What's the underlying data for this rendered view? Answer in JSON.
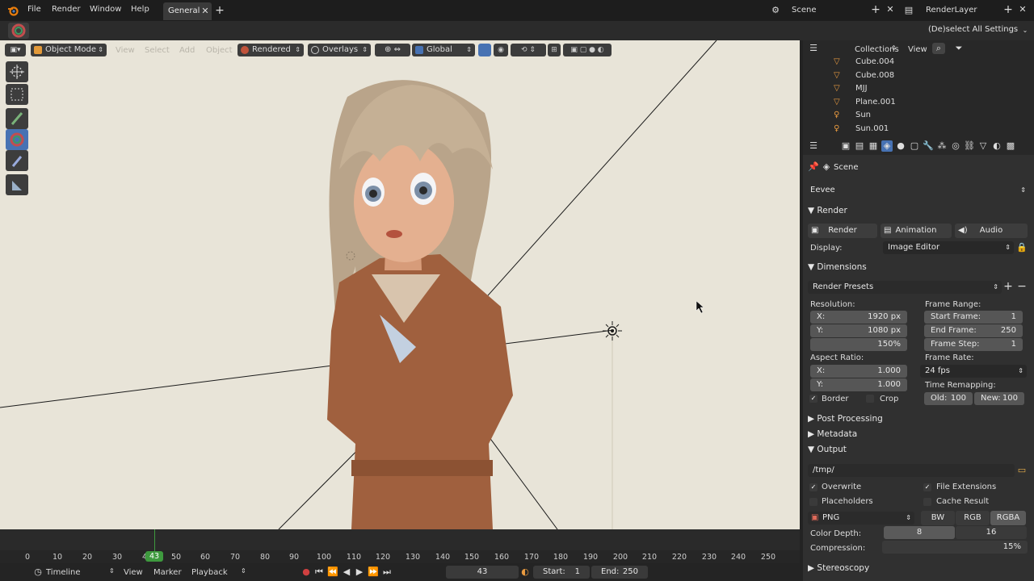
{
  "topbar": {
    "menus": [
      "File",
      "Render",
      "Window",
      "Help"
    ],
    "active_tab": "General",
    "add_tab": "+",
    "scene_name": "Scene",
    "layer_name": "RenderLayer"
  },
  "secondbar": {
    "deselect_settings": "(De)select All Settings"
  },
  "viewport": {
    "mode": "Object Mode",
    "menus": [
      "View",
      "Select",
      "Add",
      "Object"
    ],
    "shading": "Rendered",
    "overlays": "Overlays",
    "orientation": "Global"
  },
  "outliner": {
    "tabs": [
      "Collections",
      "View"
    ],
    "items": [
      "Cube.004",
      "Cube.008",
      "MJJ",
      "Plane.001",
      "Sun",
      "Sun.001"
    ]
  },
  "props": {
    "context": "Scene",
    "engine": "Eevee",
    "render_section": "Render",
    "render_buttons": [
      "Render",
      "Animation",
      "Audio"
    ],
    "display_label": "Display:",
    "display_value": "Image Editor",
    "dimensions_section": "Dimensions",
    "render_presets": "Render Presets",
    "resolution_label": "Resolution:",
    "res_x_label": "X:",
    "res_x": "1920 px",
    "res_y_label": "Y:",
    "res_y": "1080 px",
    "res_pct": "150%",
    "aspect_label": "Aspect Ratio:",
    "aspect_x_label": "X:",
    "aspect_x": "1.000",
    "aspect_y_label": "Y:",
    "aspect_y": "1.000",
    "border": "Border",
    "crop": "Crop",
    "frame_range_label": "Frame Range:",
    "start_frame_label": "Start Frame:",
    "start_frame": "1",
    "end_frame_label": "End Frame:",
    "end_frame": "250",
    "frame_step_label": "Frame Step:",
    "frame_step": "1",
    "frame_rate_label": "Frame Rate:",
    "frame_rate": "24 fps",
    "time_remap_label": "Time Remapping:",
    "old_label": "Old:",
    "old_value": "100",
    "new_label": "New:",
    "new_value": "100",
    "post_processing": "Post Processing",
    "metadata": "Metadata",
    "output_section": "Output",
    "output_path": "/tmp/",
    "overwrite": "Overwrite",
    "file_extensions": "File Extensions",
    "placeholders": "Placeholders",
    "cache_result": "Cache Result",
    "format": "PNG",
    "color_modes": [
      "BW",
      "RGB",
      "RGBA"
    ],
    "color_depth_label": "Color Depth:",
    "color_depth_options": [
      "8",
      "16"
    ],
    "compression_label": "Compression:",
    "compression": "15%",
    "stereoscopy": "Stereoscopy"
  },
  "timeline": {
    "ticks": [
      "0",
      "10",
      "20",
      "30",
      "4",
      "43",
      "50",
      "60",
      "70",
      "80",
      "90",
      "100",
      "110",
      "120",
      "130",
      "140",
      "150",
      "160",
      "170",
      "180",
      "190",
      "200",
      "210",
      "220",
      "230",
      "240",
      "250"
    ],
    "current_frame": "43",
    "editor": "Timeline",
    "menus": [
      "View",
      "Marker",
      "Playback"
    ],
    "frame_field": "43",
    "start_label": "Start:",
    "start": "1",
    "end_label": "End:",
    "end": "250"
  },
  "colors": {
    "accent_blue": "#4772b3",
    "frame_green": "#3e9a3e",
    "viewport_bg": "#e8e4d8"
  }
}
